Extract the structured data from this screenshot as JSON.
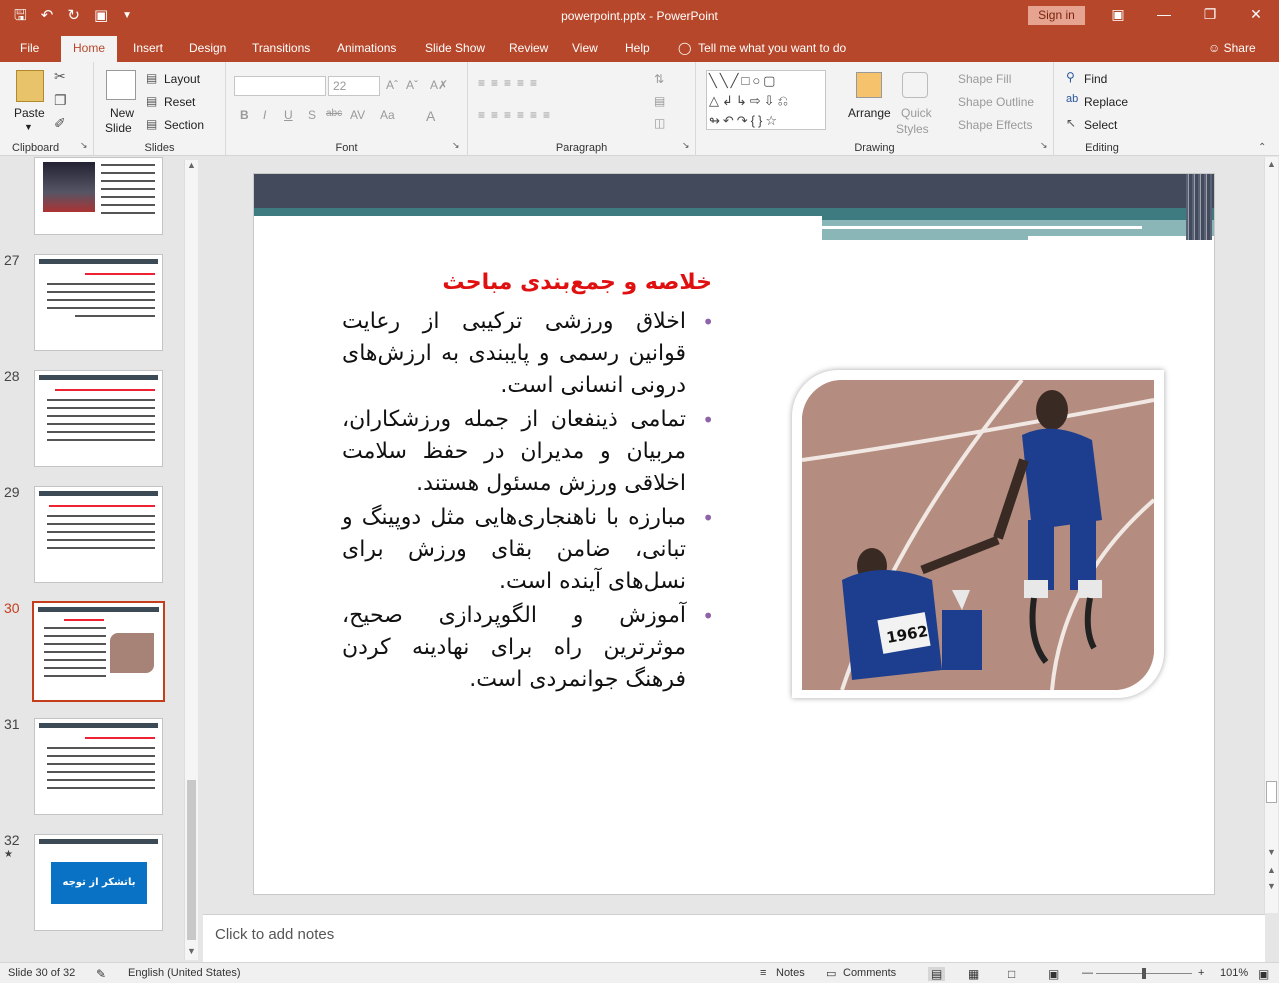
{
  "titlebar": {
    "title": "powerpoint.pptx  -  PowerPoint",
    "sign_in": "Sign in"
  },
  "tabs": [
    "File",
    "Home",
    "Insert",
    "Design",
    "Transitions",
    "Animations",
    "Slide Show",
    "Review",
    "View",
    "Help"
  ],
  "tell_me": "Tell me what you want to do",
  "share": "Share",
  "ribbon": {
    "clipboard": {
      "paste": "Paste",
      "label": "Clipboard"
    },
    "slides": {
      "new_slide_1": "New",
      "new_slide_2": "Slide",
      "layout": "Layout",
      "reset": "Reset",
      "section": "Section",
      "label": "Slides"
    },
    "font": {
      "size": "22",
      "bold": "B",
      "italic": "I",
      "underline": "U",
      "shadow": "S",
      "strike": "abc",
      "label": "Font"
    },
    "paragraph": {
      "label": "Paragraph"
    },
    "drawing": {
      "arrange": "Arrange",
      "quick_styles_1": "Quick",
      "quick_styles_2": "Styles",
      "shape_fill": "Shape Fill",
      "shape_outline": "Shape Outline",
      "shape_effects": "Shape Effects",
      "label": "Drawing"
    },
    "editing": {
      "find": "Find",
      "replace": "Replace",
      "select": "Select",
      "label": "Editing"
    }
  },
  "thumbnails": [
    {
      "num": "27",
      "title": "بخش اول"
    },
    {
      "num": "28",
      "title": "بخش دوم"
    },
    {
      "num": "29",
      "title": "بخش سوم"
    },
    {
      "num": "30",
      "title": "خلاصه و جمع‌بندی مباحث"
    },
    {
      "num": "31",
      "title": "بخش پنجم"
    },
    {
      "num": "32",
      "title": "باتشکر از توجه شما"
    }
  ],
  "slide": {
    "title": "خلاصه و جمع‌بندی مباحث",
    "bullets": [
      "اخلاق ورزشی ترکیبی از رعایت قوانین رسمی و پایبندی به ارزش‌های درونی انسانی است.",
      "تمامی ذینفعان از جمله ورزشکاران، مربیان و مدیران در حفظ سلامت اخلاقی ورزش مسئول هستند.",
      "مبارزه با ناهنجاری‌هایی مثل دوپینگ و تبانی، ضامن بقای ورزش برای نسل‌های آینده است.",
      "آموزش و الگوپردازی صحیح، موثرترین راه برای نهادینه کردن فرهنگ جوانمردی است."
    ],
    "bib_number": "1962"
  },
  "notes_placeholder": "Click to add notes",
  "status": {
    "slide_info": "Slide 30 of 32",
    "language": "English (United States)",
    "notes": "Notes",
    "comments": "Comments",
    "zoom": "101%"
  }
}
